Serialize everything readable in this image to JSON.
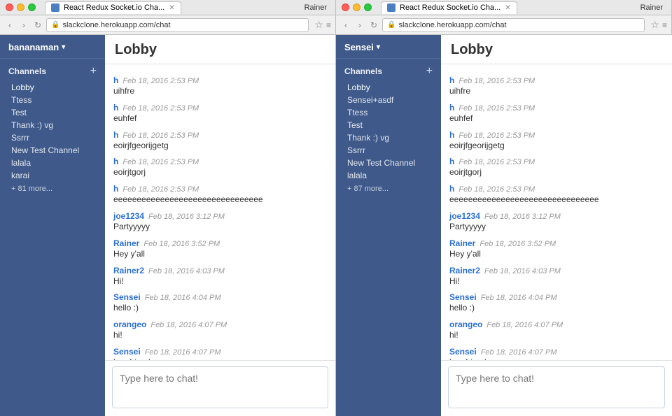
{
  "windows": [
    {
      "id": "window-left",
      "tab_title": "React Redux Socket.io Cha...",
      "url": "slackclone.herokuapp.com/chat",
      "user": "Rainer",
      "sidebar": {
        "username": "bananaman",
        "channels_label": "Channels",
        "channels": [
          {
            "name": "Lobby",
            "active": true
          },
          {
            "name": "Ttess"
          },
          {
            "name": "Test"
          },
          {
            "name": "Thank :) vg"
          },
          {
            "name": "Ssrrr"
          },
          {
            "name": "New Test Channel"
          },
          {
            "name": "lalala"
          },
          {
            "name": "karai"
          }
        ],
        "more_label": "+ 81 more..."
      },
      "chat": {
        "title": "Lobby",
        "messages": [
          {
            "author": "h",
            "author_class": "author-h",
            "time": "Feb 18, 2016 2:53 PM",
            "text": "uihfre"
          },
          {
            "author": "h",
            "author_class": "author-h",
            "time": "Feb 18, 2016 2:53 PM",
            "text": "euhfef"
          },
          {
            "author": "h",
            "author_class": "author-h",
            "time": "Feb 18, 2016 2:53 PM",
            "text": "eoirjfgeorijgetg"
          },
          {
            "author": "h",
            "author_class": "author-h",
            "time": "Feb 18, 2016 2:53 PM",
            "text": "eoirjtgorj"
          },
          {
            "author": "h",
            "author_class": "author-h",
            "time": "Feb 18, 2016 2:53 PM",
            "text": "eeeeeeeeeeeeeeeeeeeeeeeeeeeeeeee"
          },
          {
            "author": "joe1234",
            "author_class": "author-joe1234",
            "time": "Feb 18, 2016 3:12 PM",
            "text": "Partyyyyy"
          },
          {
            "author": "Rainer",
            "author_class": "author-rainer",
            "time": "Feb 18, 2016 3:52 PM",
            "text": "Hey y'all"
          },
          {
            "author": "Rainer2",
            "author_class": "author-rainer2",
            "time": "Feb 18, 2016 4:03 PM",
            "text": "Hi!"
          },
          {
            "author": "Sensei",
            "author_class": "author-sensei",
            "time": "Feb 18, 2016 4:04 PM",
            "text": "hello :)"
          },
          {
            "author": "orangeo",
            "author_class": "author-orangeo",
            "time": "Feb 18, 2016 4:07 PM",
            "text": "hi!"
          },
          {
            "author": "Sensei",
            "author_class": "author-sensei",
            "time": "Feb 18, 2016 4:07 PM",
            "text": "hey friend"
          }
        ],
        "input_placeholder": "Type here to chat!"
      }
    },
    {
      "id": "window-right",
      "tab_title": "React Redux Socket.io Cha...",
      "url": "slackclone.herokuapp.com/chat",
      "user": "Rainer",
      "sidebar": {
        "username": "Sensei",
        "channels_label": "Channels",
        "channels": [
          {
            "name": "Lobby",
            "active": true
          },
          {
            "name": "Sensei+asdf"
          },
          {
            "name": "Ttess"
          },
          {
            "name": "Test"
          },
          {
            "name": "Thank :) vg"
          },
          {
            "name": "Ssrrr"
          },
          {
            "name": "New Test Channel"
          },
          {
            "name": "lalala"
          }
        ],
        "more_label": "+ 87 more..."
      },
      "chat": {
        "title": "Lobby",
        "messages": [
          {
            "author": "h",
            "author_class": "author-h",
            "time": "Feb 18, 2016 2:53 PM",
            "text": "uihfre"
          },
          {
            "author": "h",
            "author_class": "author-h",
            "time": "Feb 18, 2016 2:53 PM",
            "text": "euhfef"
          },
          {
            "author": "h",
            "author_class": "author-h",
            "time": "Feb 18, 2016 2:53 PM",
            "text": "eoirjfgeorijgetg"
          },
          {
            "author": "h",
            "author_class": "author-h",
            "time": "Feb 18, 2016 2:53 PM",
            "text": "eoirjtgorj"
          },
          {
            "author": "h",
            "author_class": "author-h",
            "time": "Feb 18, 2016 2:53 PM",
            "text": "eeeeeeeeeeeeeeeeeeeeeeeeeeeeeeee"
          },
          {
            "author": "joe1234",
            "author_class": "author-joe1234",
            "time": "Feb 18, 2016 3:12 PM",
            "text": "Partyyyyy"
          },
          {
            "author": "Rainer",
            "author_class": "author-rainer",
            "time": "Feb 18, 2016 3:52 PM",
            "text": "Hey y'all"
          },
          {
            "author": "Rainer2",
            "author_class": "author-rainer2",
            "time": "Feb 18, 2016 4:03 PM",
            "text": "Hi!"
          },
          {
            "author": "Sensei",
            "author_class": "author-sensei",
            "time": "Feb 18, 2016 4:04 PM",
            "text": "hello :)"
          },
          {
            "author": "orangeo",
            "author_class": "author-orangeo",
            "time": "Feb 18, 2016 4:07 PM",
            "text": "hi!"
          },
          {
            "author": "Sensei",
            "author_class": "author-sensei",
            "time": "Feb 18, 2016 4:07 PM",
            "text": "hey friend"
          }
        ],
        "input_placeholder": "Type here to chat!"
      }
    }
  ]
}
